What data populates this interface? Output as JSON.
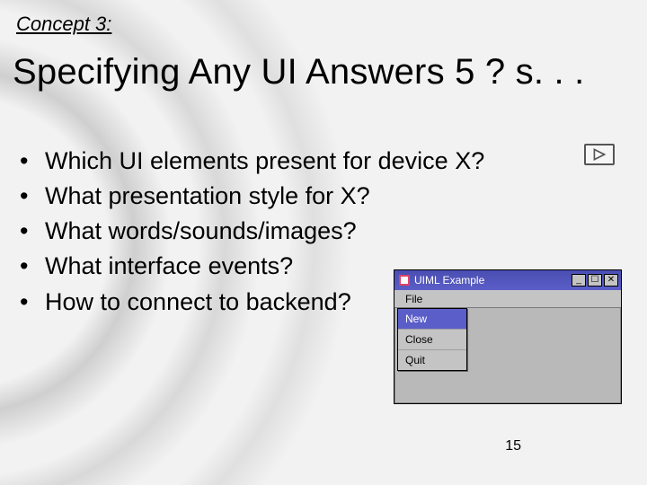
{
  "concept_label": "Concept 3:",
  "title": "Specifying Any UI Answers 5 ? s. . .",
  "bullets": [
    "Which UI elements present for device X?",
    "What presentation style for X?",
    "What words/sounds/images?",
    "What interface events?",
    "How to connect to backend?"
  ],
  "page_number": "15",
  "uiml_window": {
    "title": "UIML Example",
    "menubar": [
      "File"
    ],
    "dropdown": {
      "items": [
        "New",
        "Close",
        "Quit"
      ],
      "active_index": 0
    },
    "buttons": {
      "min": "_",
      "max": "☐",
      "close": "✕"
    }
  }
}
